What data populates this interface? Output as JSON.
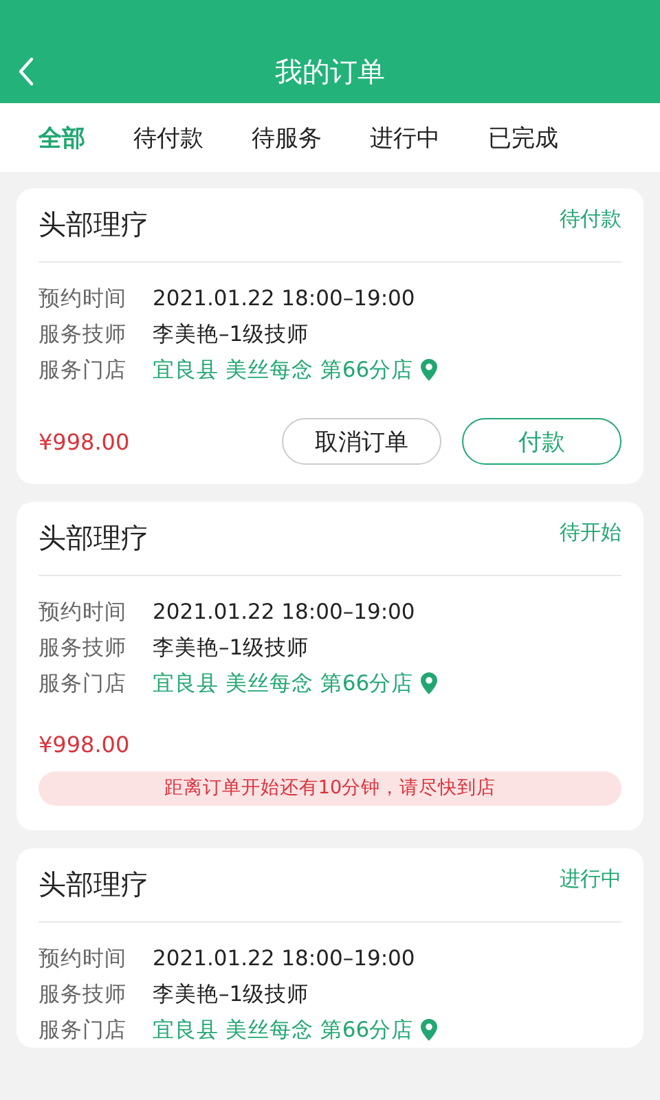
{
  "header": {
    "title": "我的订单"
  },
  "tabs": [
    {
      "label": "全部",
      "selected": true
    },
    {
      "label": "待付款",
      "selected": false
    },
    {
      "label": "待服务",
      "selected": false
    },
    {
      "label": "进行中",
      "selected": false
    },
    {
      "label": "已完成",
      "selected": false
    }
  ],
  "orders": [
    {
      "title": "头部理疗",
      "status": "待付款",
      "details": [
        {
          "label": "预约时间",
          "value": "2021.01.22 18:00–19:00",
          "kind": "text"
        },
        {
          "label": "服务技师",
          "value": "李美艳–1级技师",
          "kind": "text"
        },
        {
          "label": "服务门店",
          "value": "宜良县 美丝每念 第66分店",
          "kind": "store"
        }
      ],
      "price": "¥998.00",
      "buttons": [
        {
          "label": "取消订单",
          "kind": "secondary"
        },
        {
          "label": "付款",
          "kind": "primary"
        }
      ]
    },
    {
      "title": "头部理疗",
      "status": "待开始",
      "details": [
        {
          "label": "预约时间",
          "value": "2021.01.22 18:00–19:00",
          "kind": "text"
        },
        {
          "label": "服务技师",
          "value": "李美艳–1级技师",
          "kind": "text"
        },
        {
          "label": "服务门店",
          "value": "宜良县 美丝每念 第66分店",
          "kind": "store"
        }
      ],
      "price": "¥998.00",
      "notice": "距离订单开始还有10分钟，请尽快到店"
    },
    {
      "title": "头部理疗",
      "status": "进行中",
      "details": [
        {
          "label": "预约时间",
          "value": "2021.01.22 18:00–19:00",
          "kind": "text"
        },
        {
          "label": "服务技师",
          "value": "李美艳–1级技师",
          "kind": "text"
        },
        {
          "label": "服务门店",
          "value": "宜良县 美丝每念 第66分店",
          "kind": "store"
        }
      ]
    }
  ]
}
